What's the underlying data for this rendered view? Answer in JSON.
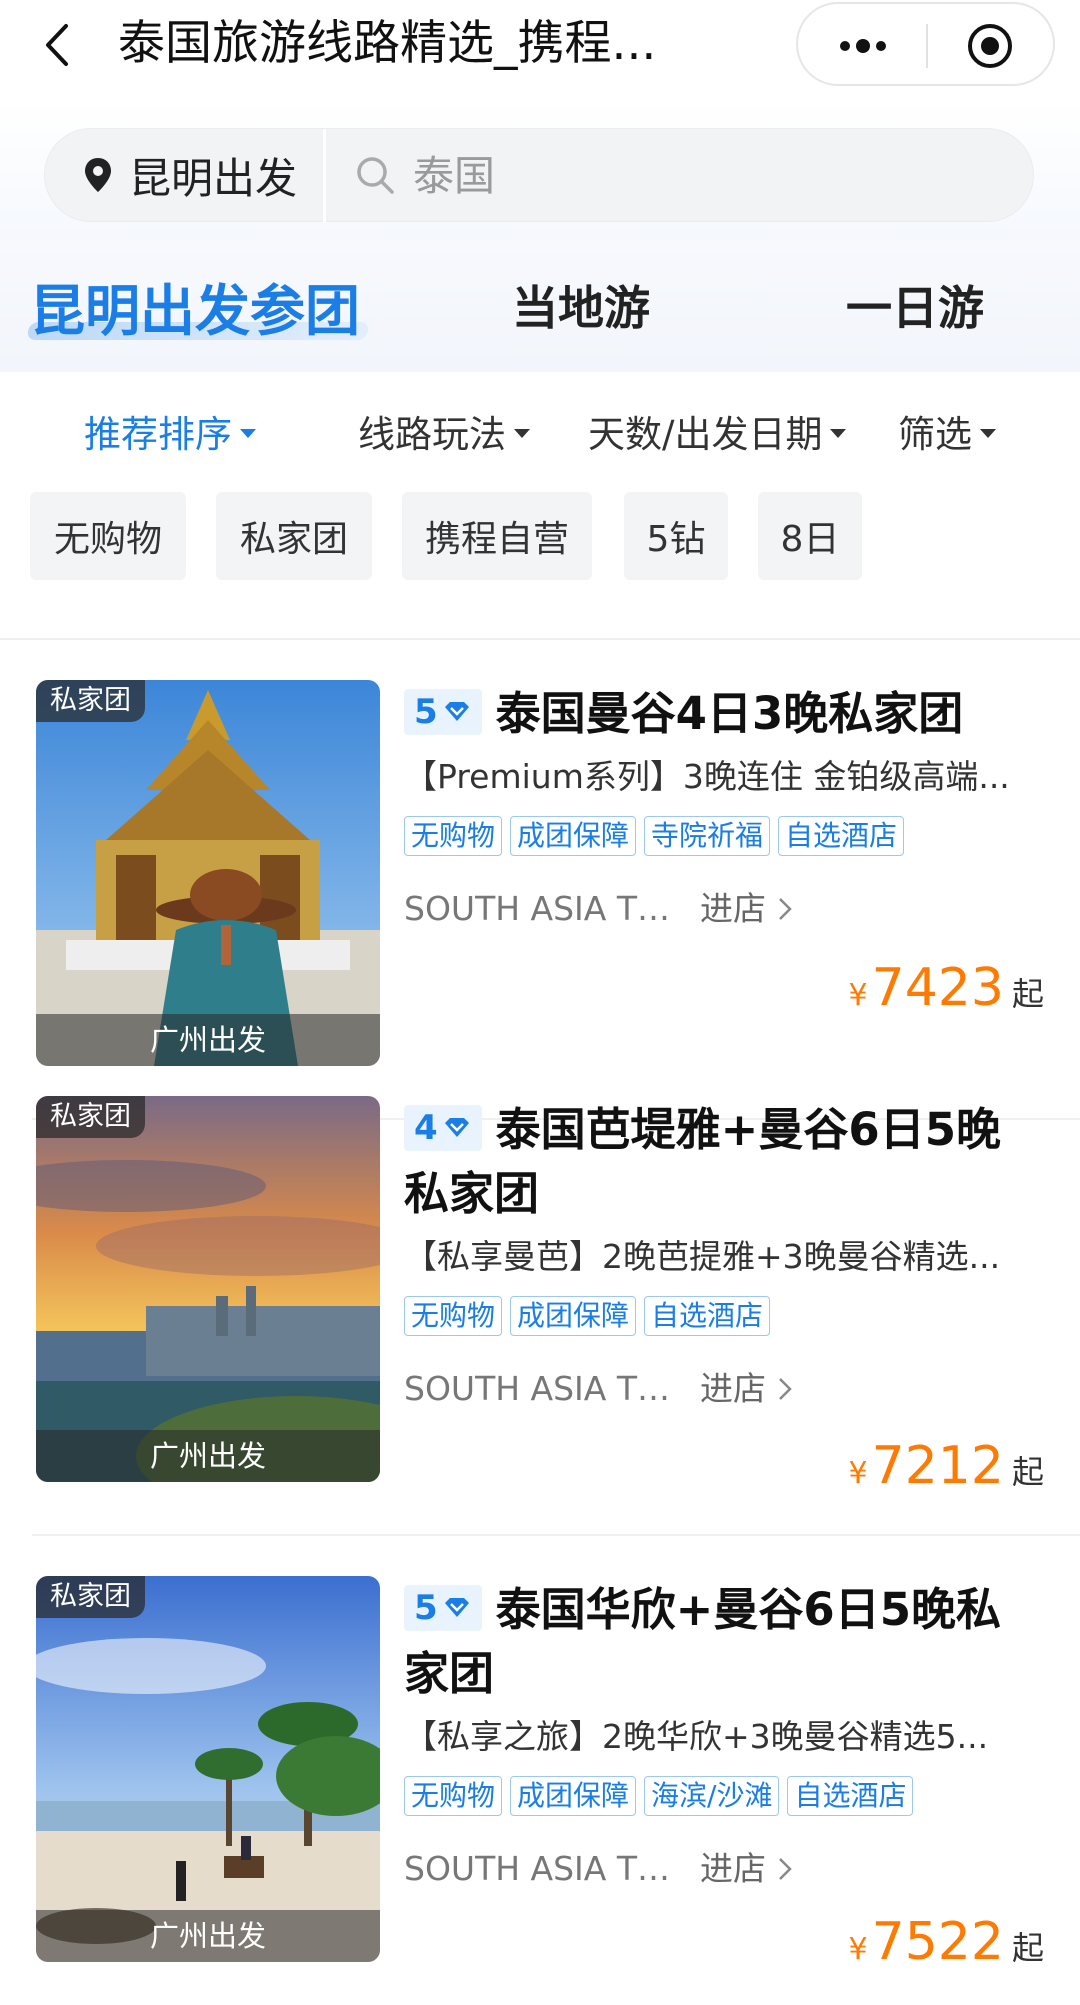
{
  "header": {
    "title": "泰国旅游线路精选_携程...",
    "more_icon": "more-dots-icon",
    "close_icon": "record-circle-icon"
  },
  "search": {
    "city": "昆明出发",
    "placeholder": "泰国"
  },
  "tabs": [
    {
      "label": "昆明出发参团",
      "active": true
    },
    {
      "label": "当地游",
      "active": false
    },
    {
      "label": "一日游",
      "active": false
    }
  ],
  "filters": [
    {
      "label": "推荐排序",
      "active": true
    },
    {
      "label": "线路玩法",
      "active": false
    },
    {
      "label": "天数/出发日期",
      "active": false
    },
    {
      "label": "筛选",
      "active": false
    }
  ],
  "chips": [
    "无购物",
    "私家团",
    "携程自营",
    "5钻",
    "8日"
  ],
  "products": [
    {
      "badge": "私家团",
      "departure": "广州出发",
      "diamond_level": "5",
      "title": "泰国曼谷4日3晚私家团",
      "subtitle": "【Premium系列】3晚连住 金铂级高端...",
      "tags": [
        "无购物",
        "成团保障",
        "寺院祈福",
        "自选酒店"
      ],
      "vendor": "SOUTH ASIA TR...",
      "store_link": "进店",
      "currency": "¥",
      "price": "7423",
      "price_suffix": "起"
    },
    {
      "badge": "私家团",
      "departure": "广州出发",
      "diamond_level": "4",
      "title": "泰国芭堤雅+曼谷6日5晚私家团",
      "subtitle": "【私享曼芭】2晚芭提雅+3晚曼谷精选...",
      "tags": [
        "无购物",
        "成团保障",
        "自选酒店"
      ],
      "vendor": "SOUTH ASIA TR...",
      "store_link": "进店",
      "currency": "¥",
      "price": "7212",
      "price_suffix": "起"
    },
    {
      "badge": "私家团",
      "departure": "广州出发",
      "diamond_level": "5",
      "title": "泰国华欣+曼谷6日5晚私家团",
      "subtitle": "【私享之旅】2晚华欣+3晚曼谷精选5...",
      "tags": [
        "无购物",
        "成团保障",
        "海滨/沙滩",
        "自选酒店"
      ],
      "vendor": "SOUTH ASIA TR...",
      "store_link": "进店",
      "currency": "¥",
      "price": "7522",
      "price_suffix": "起"
    }
  ],
  "colors": {
    "accent": "#1a7ee6",
    "price": "#ff7a00"
  }
}
